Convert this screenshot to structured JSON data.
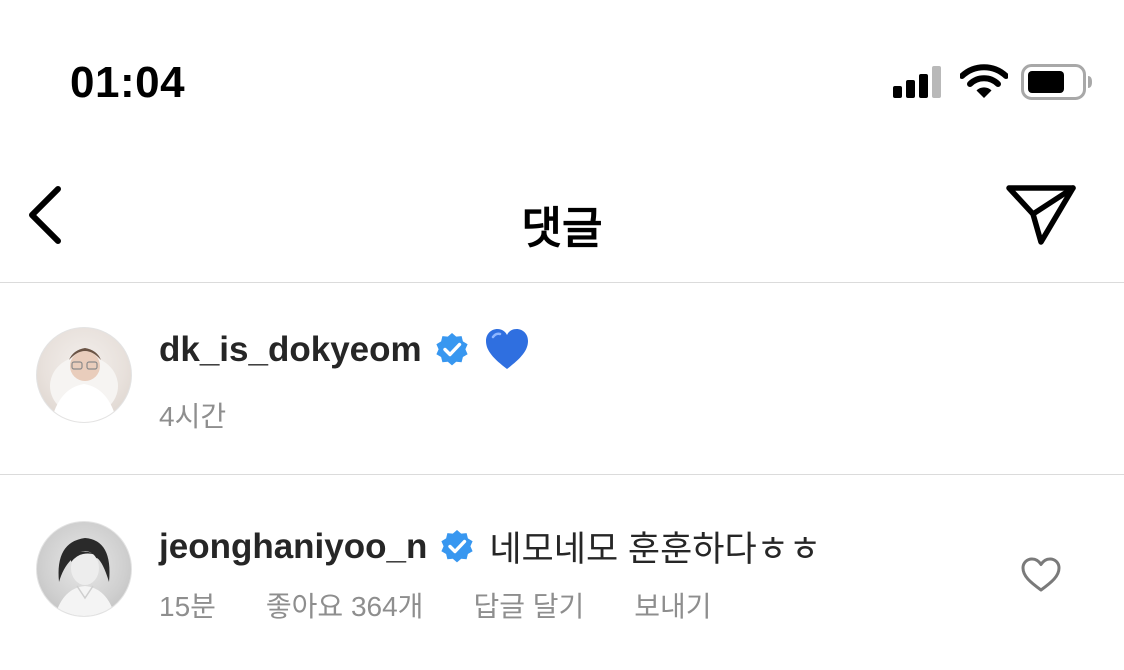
{
  "status_bar": {
    "time": "01:04",
    "icons": [
      "cellular-signal-icon",
      "wifi-icon",
      "battery-icon"
    ]
  },
  "header": {
    "title": "댓글",
    "back_icon": "chevron-left-icon",
    "share_icon": "paper-plane-icon"
  },
  "caption": {
    "username": "dk_is_dokyeom",
    "verified": true,
    "text_emoji": "blue-heart-emoji",
    "time": "4시간"
  },
  "comments": [
    {
      "username": "jeonghaniyoo_n",
      "verified": true,
      "text": "네모네모 훈훈하다ㅎㅎ",
      "time": "15분",
      "likes_label": "좋아요 364개",
      "reply_label": "답글 달기",
      "send_label": "보내기",
      "like_icon": "heart-outline-icon"
    }
  ],
  "colors": {
    "verified_badge": "#3897f0",
    "heart_emoji": "#2f6fe0",
    "secondary_text": "#8e8e8e",
    "divider": "#dbdbdb"
  }
}
